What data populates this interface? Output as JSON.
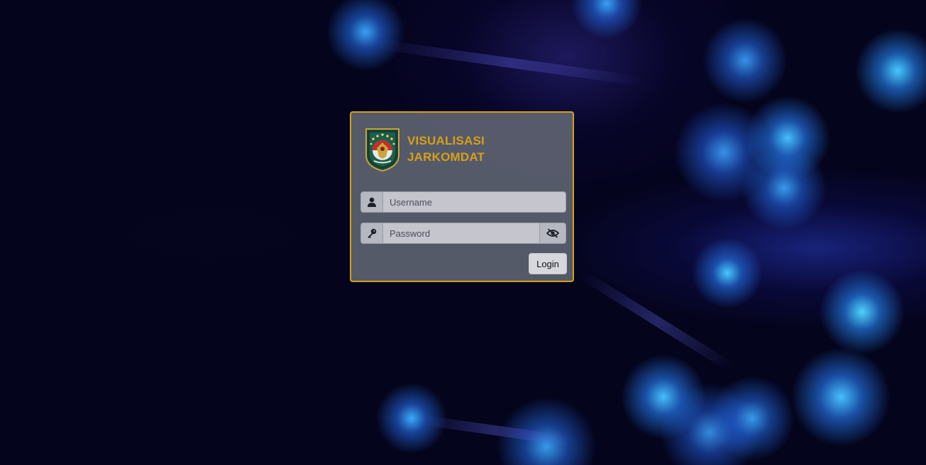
{
  "app": {
    "title_line1": "VISUALISASI",
    "title_line2": "JARKOMDAT",
    "logo_icon": "government-emblem-icon"
  },
  "form": {
    "username": {
      "placeholder": "Username",
      "value": "",
      "icon": "user-icon"
    },
    "password": {
      "placeholder": "Password",
      "value": "",
      "icon": "key-icon",
      "toggle_icon": "eye-slash-icon"
    },
    "login_label": "Login"
  },
  "colors": {
    "accent": "#d7a019",
    "card_border": "#d4a017",
    "card_bg": "#686e7a",
    "input_bg": "#c4c5cd",
    "button_bg": "#d7d8de"
  }
}
